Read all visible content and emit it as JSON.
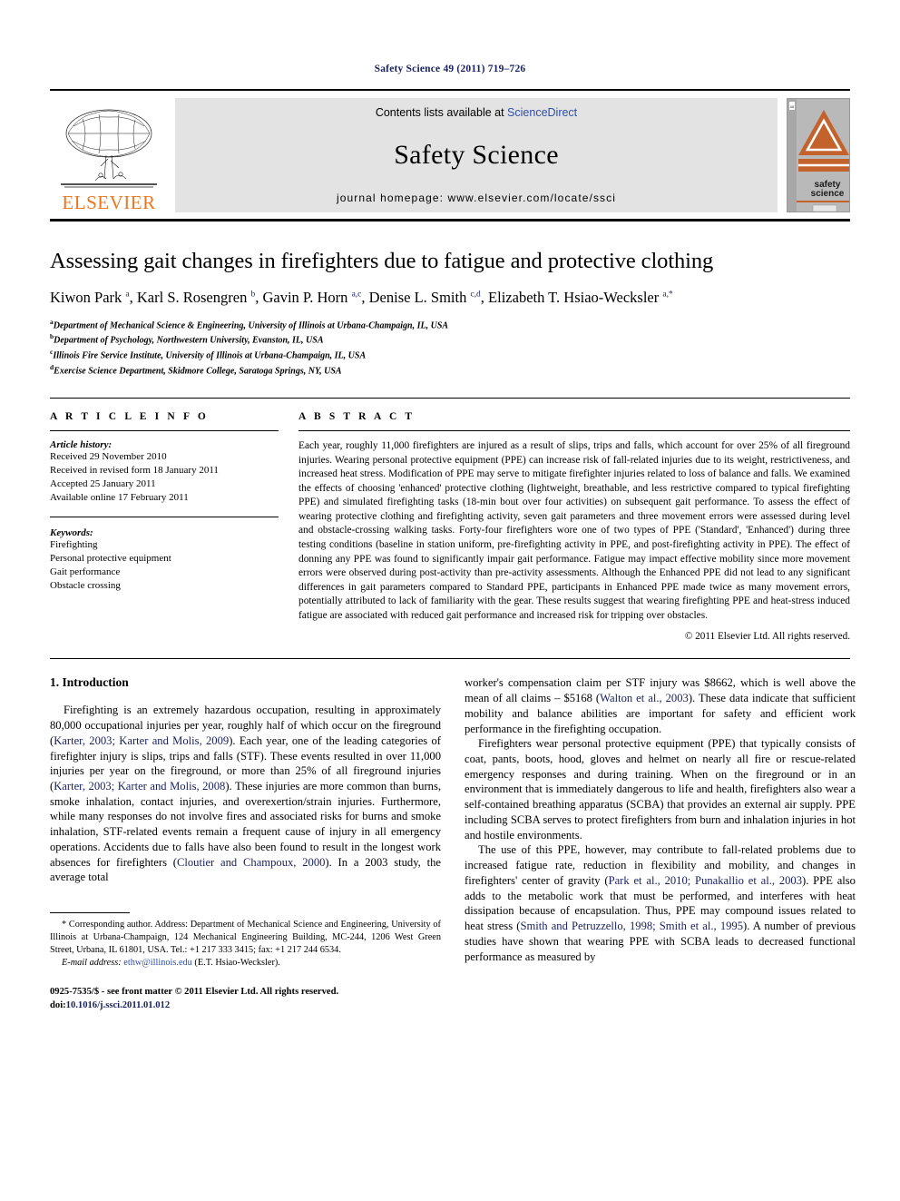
{
  "running_head": "Safety Science 49 (2011) 719–726",
  "masthead": {
    "publisher_name": "ELSEVIER",
    "contents_prefix": "Contents lists available at ",
    "contents_link": "ScienceDirect",
    "journal_title": "Safety Science",
    "homepage": "journal homepage: www.elsevier.com/locate/ssci",
    "cover_label_line1": "safety",
    "cover_label_line2": "science"
  },
  "article": {
    "title": "Assessing gait changes in firefighters due to fatigue and protective clothing",
    "authors_html": "Kiwon Park <sup>a</sup>, Karl S. Rosengren <sup>b</sup>, Gavin P. Horn <sup>a,c</sup>, Denise L. Smith <sup>c,d</sup>, Elizabeth T. Hsiao-Wecksler <sup>a,*</sup>",
    "affiliations": [
      {
        "mark": "a",
        "text": "Department of Mechanical Science & Engineering, University of Illinois at Urbana-Champaign, IL, USA"
      },
      {
        "mark": "b",
        "text": "Department of Psychology, Northwestern University, Evanston, IL, USA"
      },
      {
        "mark": "c",
        "text": "Illinois Fire Service Institute, University of Illinois at Urbana-Champaign, IL, USA"
      },
      {
        "mark": "d",
        "text": "Exercise Science Department, Skidmore College, Saratoga Springs, NY, USA"
      }
    ]
  },
  "article_info": {
    "heading": "A R T I C L E    I N F O",
    "history_label": "Article history:",
    "history": [
      "Received 29 November 2010",
      "Received in revised form 18 January 2011",
      "Accepted 25 January 2011",
      "Available online 17 February 2011"
    ],
    "keywords_label": "Keywords:",
    "keywords": [
      "Firefighting",
      "Personal protective equipment",
      "Gait performance",
      "Obstacle crossing"
    ]
  },
  "abstract": {
    "heading": "A B S T R A C T",
    "text": "Each year, roughly 11,000 firefighters are injured as a result of slips, trips and falls, which account for over 25% of all fireground injuries. Wearing personal protective equipment (PPE) can increase risk of fall-related injuries due to its weight, restrictiveness, and increased heat stress. Modification of PPE may serve to mitigate firefighter injuries related to loss of balance and falls. We examined the effects of choosing 'enhanced' protective clothing (lightweight, breathable, and less restrictive compared to typical firefighting PPE) and simulated firefighting tasks (18-min bout over four activities) on subsequent gait performance. To assess the effect of wearing protective clothing and firefighting activity, seven gait parameters and three movement errors were assessed during level and obstacle-crossing walking tasks. Forty-four firefighters wore one of two types of PPE ('Standard', 'Enhanced') during three testing conditions (baseline in station uniform, pre-firefighting activity in PPE, and post-firefighting activity in PPE). The effect of donning any PPE was found to significantly impair gait performance. Fatigue may impact effective mobility since more movement errors were observed during post-activity than pre-activity assessments. Although the Enhanced PPE did not lead to any significant differences in gait parameters compared to Standard PPE, participants in Enhanced PPE made twice as many movement errors, potentially attributed to lack of familiarity with the gear. These results suggest that wearing firefighting PPE and heat-stress induced fatigue are associated with reduced gait performance and increased risk for tripping over obstacles.",
    "copyright": "© 2011 Elsevier Ltd. All rights reserved."
  },
  "introduction": {
    "heading": "1. Introduction",
    "left_p1_html": "Firefighting is an extremely hazardous occupation, resulting in approximately 80,000 occupational injuries per year, roughly half of which occur on the fireground (<span class=\"ref\">Karter, 2003; Karter and Molis, 2009</span>). Each year, one of the leading categories of firefighter injury is slips, trips and falls (STF). These events resulted in over 11,000 injuries per year on the fireground, or more than 25% of all fireground injuries (<span class=\"ref\">Karter, 2003; Karter and Molis, 2008</span>). These injuries are more common than burns, smoke inhalation, contact injuries, and overexertion/strain injuries. Furthermore, while many responses do not involve fires and associated risks for burns and smoke inhalation, STF-related events remain a frequent cause of injury in all emergency operations. Accidents due to falls have also been found to result in the longest work absences for firefighters (<span class=\"ref\">Cloutier and Champoux, 2000</span>). In a 2003 study, the average total",
    "right_p1_html": "worker's compensation claim per STF injury was $8662, which is well above the mean of all claims – $5168 (<span class=\"ref\">Walton et al., 2003</span>). These data indicate that sufficient mobility and balance abilities are important for safety and efficient work performance in the firefighting occupation.",
    "right_p2_html": "Firefighters wear personal protective equipment (PPE) that typically consists of coat, pants, boots, hood, gloves and helmet on nearly all fire or rescue-related emergency responses and during training. When on the fireground or in an environment that is immediately dangerous to life and health, firefighters also wear a self-contained breathing apparatus (SCBA) that provides an external air supply. PPE including SCBA serves to protect firefighters from burn and inhalation injuries in hot and hostile environments.",
    "right_p3_html": "The use of this PPE, however, may contribute to fall-related problems due to increased fatigue rate, reduction in flexibility and mobility, and changes in firefighters' center of gravity (<span class=\"ref\">Park et al., 2010; Punakallio et al., 2003</span>). PPE also adds to the metabolic work that must be performed, and interferes with heat dissipation because of encapsulation. Thus, PPE may compound issues related to heat stress (<span class=\"ref\">Smith and Petruzzello, 1998; Smith et al., 1995</span>). A number of previous studies have shown that wearing PPE with SCBA leads to decreased functional performance as measured by"
  },
  "footnote": {
    "corresponding_html": "* Corresponding author. Address: Department of Mechanical Science and Engineering, University of Illinois at Urbana-Champaign, 124 Mechanical Engineering Building, MC-244, 1206 West Green Street, Urbana, IL 61801, USA. Tel.: +1 217 333 3415; fax: +1 217 244 6534.",
    "email_label": "E-mail address:",
    "email": "ethw@illinois.edu",
    "email_owner": "(E.T. Hsiao-Wecksler)."
  },
  "imprint": {
    "line1": "0925-7535/$ - see front matter © 2011 Elsevier Ltd. All rights reserved.",
    "doi_label": "doi:",
    "doi": "10.1016/j.ssci.2011.01.012"
  },
  "colors": {
    "navy": "#16205e",
    "link_blue": "#2f4fa8",
    "elsevier_orange": "#E87722",
    "banner_gray": "#e3e3e3"
  }
}
